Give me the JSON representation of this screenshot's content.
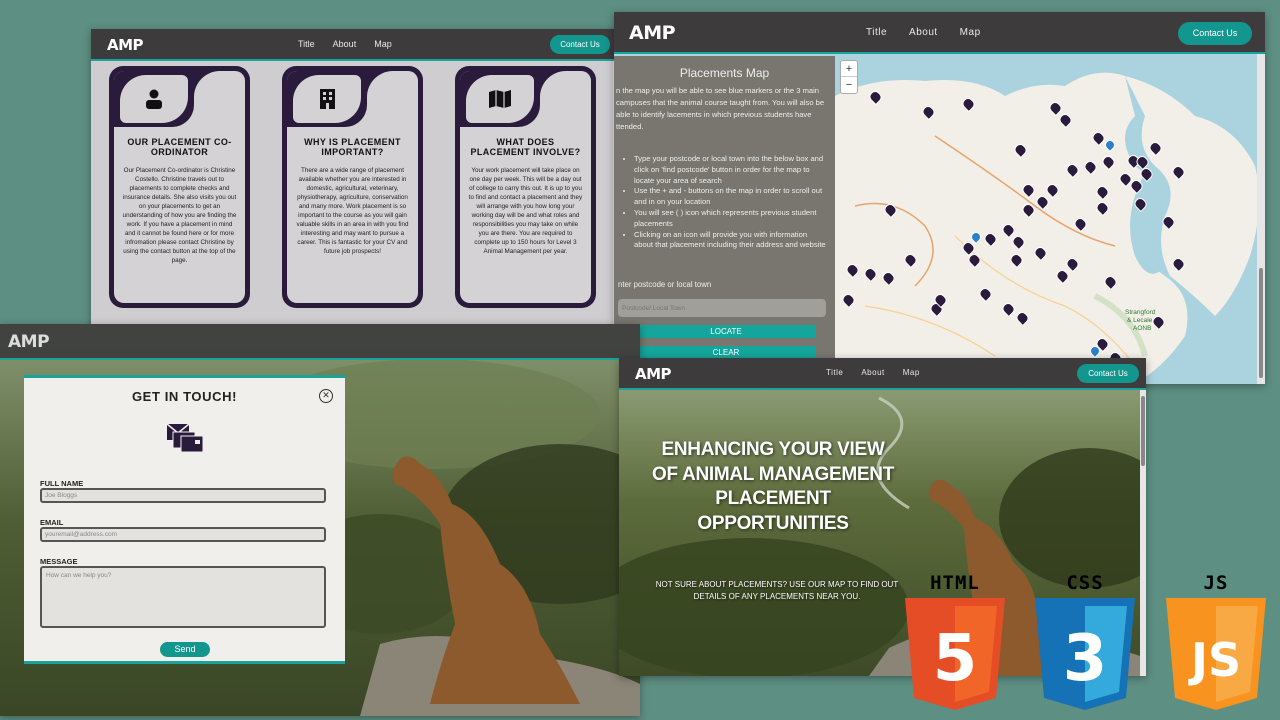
{
  "brand": {
    "logo": "AMP",
    "accent": "#12968e",
    "card_color": "#2a1b3d"
  },
  "nav": {
    "links": [
      "Title",
      "About",
      "Map"
    ],
    "contact_label": "Contact Us"
  },
  "cards_window": {
    "cards": [
      {
        "icon": "person-icon",
        "title": "OUR PLACEMENT CO-ORDINATOR",
        "text": "Our Placement Co-ordinator is Christine Costello. Christine travels out to placements to complete checks and insurance details. She also visits you out on your placements to get an understanding of how you are finding the work. If you have a placement in mind and it cannot be found here or for more infromation please contact Christine by using the contact button at the top of the page."
      },
      {
        "icon": "building-icon",
        "title": "WHY IS PLACEMENT IMPORTANT?",
        "text": "There are a wide range of placement available whether you are interested in domestic, agricultural, veterinary, physiotherapy, agriculture, conservation and many more. Work placement is so important to the course as you will gain valuable skills in an area in with you find interesting and may want to pursue a career. This is fantastic for your CV and future job prospects!"
      },
      {
        "icon": "map-icon",
        "title": "WHAT DOES PLACEMENT INVOLVE?",
        "text": "Your work placement will take place on one day per week. This will be a day out of college to carry this out. It is up to you to find and contact a placement and they will arrange with you how long your working day will be and what roles and responsibilities you may take on while you are there. You are required to complete up to 150 hours for Level 3 Animal Management per year."
      }
    ]
  },
  "map_window": {
    "heading": "Placements Map",
    "intro": "n the map you will be able to see blue markers or the 3 main campuses that the animal course taught from. You will also be able to identify lacements in which previous students have ttended.",
    "instructions": [
      "Type your postcode or local town into the below box and click on 'find postcode' button in order for the map to locate your area of search",
      "Use the + and - buttons on the map in order to scroll out and in on your location",
      "You will see ( ) icon which represents previous student placements",
      "Clicking on an icon will provide you with information about that placement including their address and website"
    ],
    "input_label": "nter postcode or local town",
    "input_placeholder": "Postcode/ Local Town",
    "locate_label": "LOCATE",
    "clear_label": "CLEAR",
    "zoom_in": "+",
    "zoom_out": "−",
    "place_labels": [
      "Strangford & Lecale AONB"
    ]
  },
  "contact_window": {
    "title": "GET IN TOUCH!",
    "close": "✕",
    "fields": [
      {
        "label": "FULL NAME",
        "placeholder": "Joe Bloggs"
      },
      {
        "label": "EMAIL",
        "placeholder": "youremail@address.com"
      },
      {
        "label": "MESSAGE",
        "placeholder": "How can we help you?"
      }
    ],
    "send_label": "Send"
  },
  "hero_window": {
    "title": "ENHANCING YOUR VIEW OF ANIMAL MANAGEMENT PLACEMENT OPPORTUNITIES",
    "subtitle": "NOT SURE ABOUT PLACEMENTS? USE OUR MAP TO FIND OUT DETAILS OF ANY PLACEMENTS NEAR YOU."
  },
  "tech_badges": [
    {
      "label": "HTML",
      "number": "5",
      "color": "#e44d26"
    },
    {
      "label": "CSS",
      "number": "3",
      "color": "#1572b6"
    },
    {
      "label": "JS",
      "number": "JS",
      "color": "#f7931e"
    }
  ]
}
